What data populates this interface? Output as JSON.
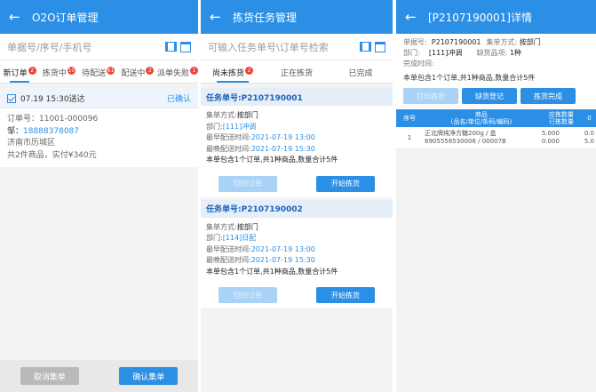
{
  "panel1": {
    "title": "O2O订单管理",
    "search_placeholder": "单据号/序号/手机号",
    "tabs": [
      {
        "label": "新订单",
        "badge": "2"
      },
      {
        "label": "拣货中",
        "badge": "10"
      },
      {
        "label": "待配送",
        "badge": "61"
      },
      {
        "label": "配送中",
        "badge": "2"
      },
      {
        "label": "派单失败",
        "badge": "1"
      }
    ],
    "order": {
      "time_line": "07.19 15:30送达",
      "status": "已确认",
      "order_no": "订单号：11001-000096",
      "contact_label": "邹：",
      "phone": "18888378087",
      "address": "济南市历城区",
      "summary": "共2件商品，实付¥340元"
    },
    "cancel_button": "取消集单",
    "confirm_button": "确认集单"
  },
  "panel2": {
    "title": "拣货任务管理",
    "search_placeholder": "可输入任务单号\\订单号检索",
    "tabs": [
      {
        "label": "尚未拣货",
        "badge": "2"
      },
      {
        "label": "正在拣货",
        "badge": ""
      },
      {
        "label": "已完成",
        "badge": ""
      }
    ],
    "tasks": [
      {
        "task_no": "任务单号:P2107190001",
        "mode_label": "集单方式:",
        "mode": "按部门",
        "dept_label": "部门:",
        "dept": "[111]冲调",
        "earliest_label": "最早配送时间:",
        "earliest": "2021-07-19 13:00",
        "latest_label": "最晚配送时间:",
        "latest": "2021-07-19 15:30",
        "summary": "本单包含1个订单,共1种商品,数量合计5件",
        "left_button": "回归订单",
        "start_button": "开始拣货"
      },
      {
        "task_no": "任务单号:P2107190002",
        "mode_label": "集单方式:",
        "mode": "按部门",
        "dept_label": "部门:",
        "dept": "[114]日配",
        "earliest_label": "最早配送时间:",
        "earliest": "2021-07-19 13:00",
        "latest_label": "最晚配送时间:",
        "latest": "2021-07-19 15:30",
        "summary": "本单包含1个订单,共1种商品,数量合计5件",
        "left_button": "回归订单",
        "start_button": "开始拣货"
      }
    ]
  },
  "panel3": {
    "title": "[P2107190001]详情",
    "doc_label": "单据号:",
    "doc_no": "P2107190001",
    "mode_label": "集单方式:",
    "mode": "按部门",
    "dept_label": "部门:",
    "dept": "[111]冲调",
    "lack_label": "缺货品项:",
    "lack": "1种",
    "finish_label": "完成时间:",
    "summary": "本单包含1个订单,共1种商品,数量合计5件",
    "buttons": {
      "b1": "打印拣货",
      "b2": "缺货登记",
      "b3": "拣货完成"
    },
    "table": {
      "h_index": "序号",
      "h_goods_1": "商品",
      "h_goods_2": "(品名/单位/条码/编码)",
      "h_qty_1": "应拣数量",
      "h_qty_2": "已拣数量",
      "h_extra": "0",
      "row": {
        "index": "1",
        "name": "正北牌纯净方糖200g / 盒",
        "codes": "6905558530006 / 00007B",
        "qty1": "5.000",
        "qty2": "0.000",
        "extra1": "0.0",
        "extra2": "5.0"
      }
    }
  },
  "colors": {
    "primary": "#2b8fe6",
    "badge": "#e8453c"
  }
}
